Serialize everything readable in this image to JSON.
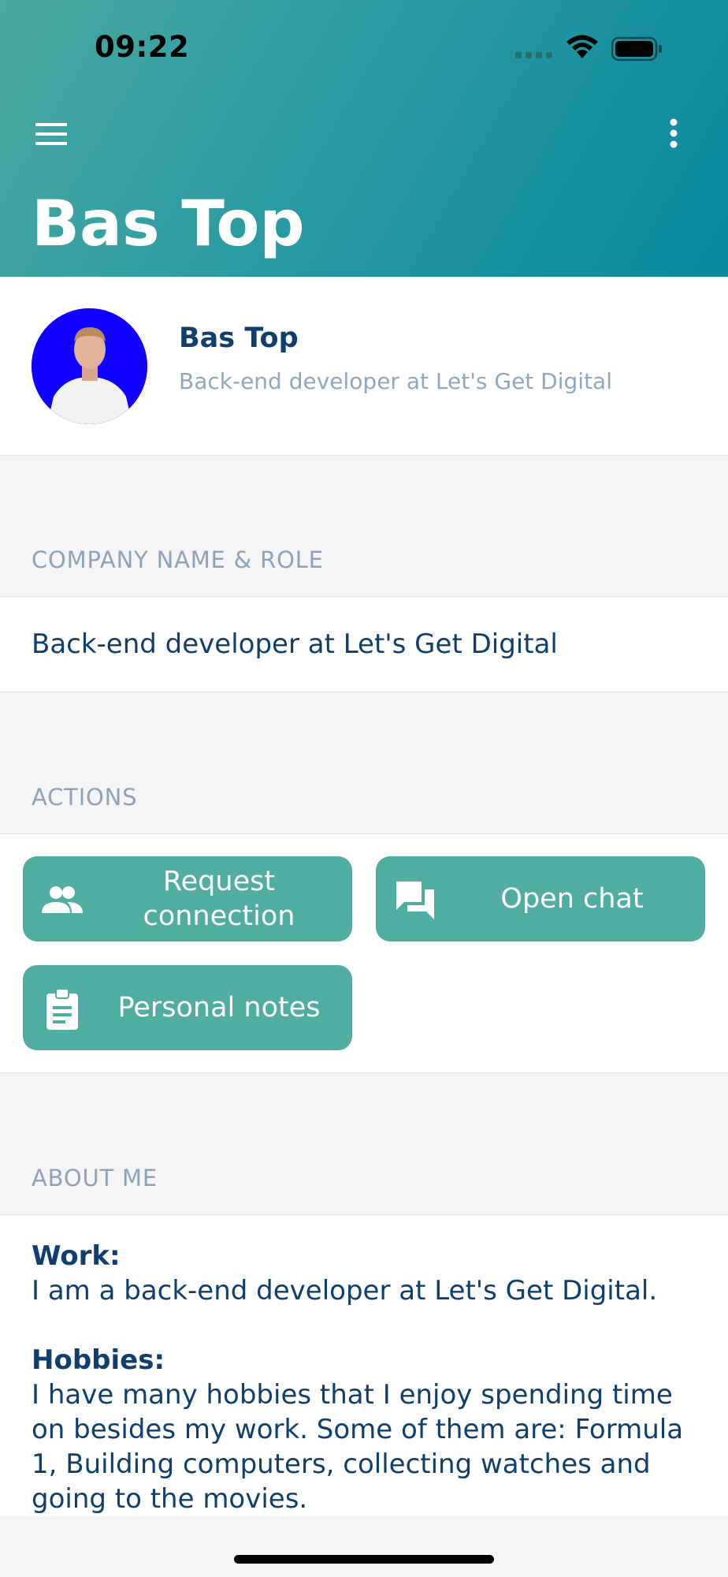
{
  "status_bar": {
    "time": "09:22",
    "icons": [
      "signal-icon",
      "wifi-icon",
      "battery-icon"
    ]
  },
  "header": {
    "title": "Bas Top",
    "menu_icon": "hamburger-menu-icon",
    "more_icon": "more-vertical-icon"
  },
  "profile": {
    "name": "Bas Top",
    "role": "Back-end developer at Let's Get Digital"
  },
  "sections": {
    "company": {
      "label": "COMPANY NAME & ROLE",
      "value": "Back-end developer at Let's Get Digital"
    },
    "actions": {
      "label": "ACTIONS",
      "buttons": [
        {
          "label": "Request connection",
          "icon": "people-icon"
        },
        {
          "label": "Open chat",
          "icon": "chat-icon"
        },
        {
          "label": "Personal notes",
          "icon": "clipboard-icon"
        }
      ]
    },
    "about": {
      "label": "ABOUT ME",
      "work_heading": "Work:",
      "work_text": "I am a back-end developer at Let's Get Digital.",
      "hobbies_heading": "Hobbies:",
      "hobbies_text": "I have many hobbies that I enjoy spending time on besides my work. Some of them are: Formula 1, Building computers, collecting watches and going to the movies."
    }
  },
  "colors": {
    "header_gradient_start": "#4aa9a0",
    "header_gradient_end": "#07889d",
    "button_bg": "#4fada2",
    "primary_text": "#0e3f6e",
    "secondary_text": "#8ea3ba",
    "avatar_bg": "#1000ff"
  }
}
